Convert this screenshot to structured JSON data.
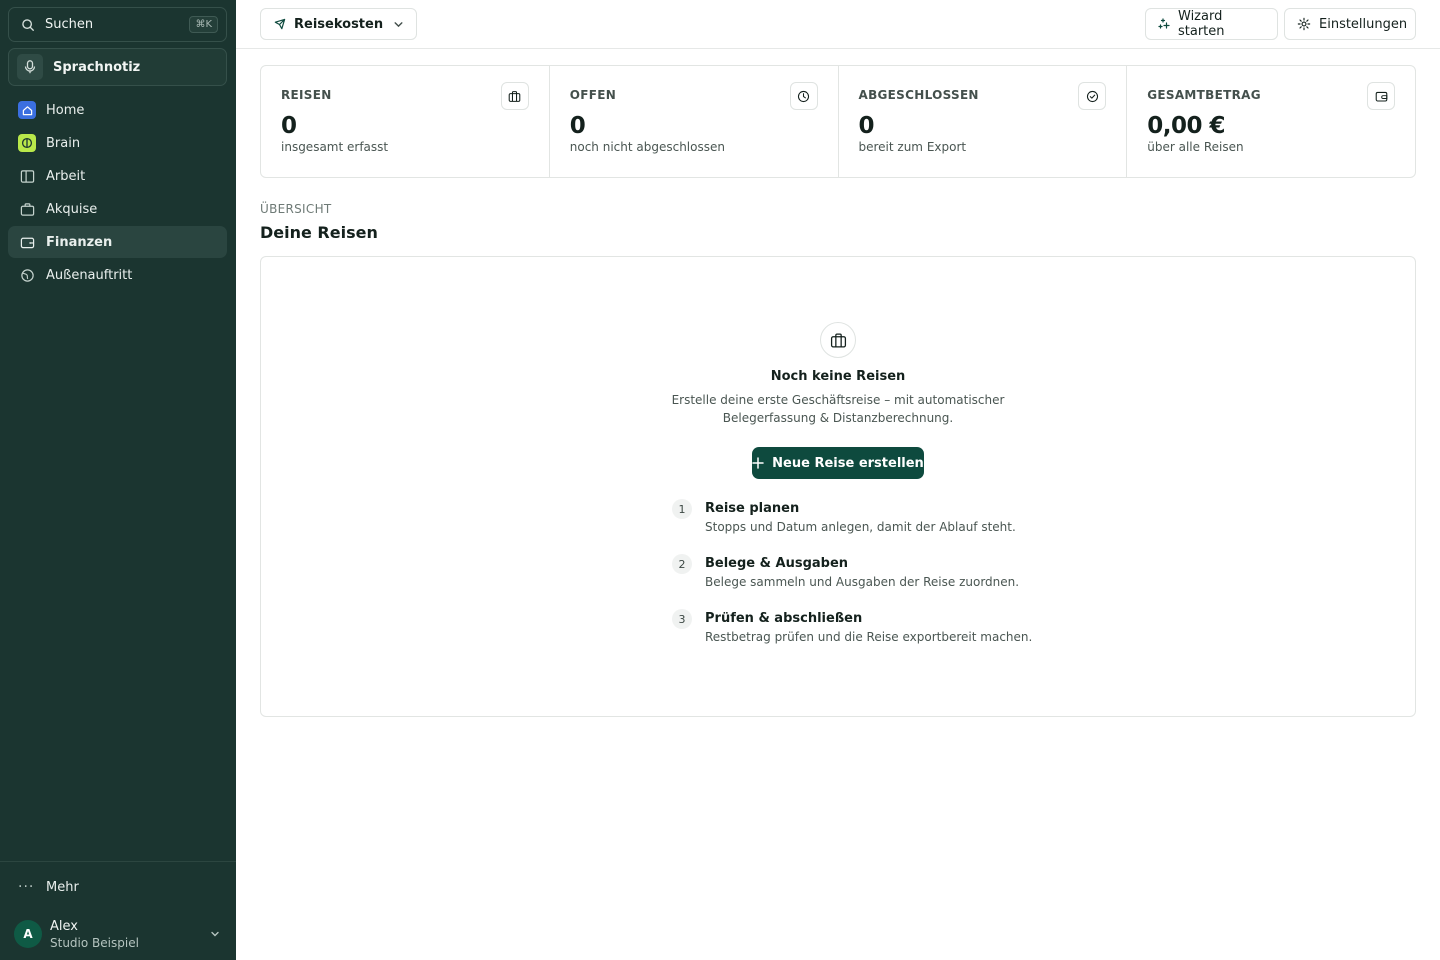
{
  "sidebar": {
    "search": {
      "label": "Suchen",
      "shortcut": "⌘K"
    },
    "voice_note": {
      "label": "Sprachnotiz"
    },
    "nav": [
      {
        "label": "Home",
        "icon": "home-icon"
      },
      {
        "label": "Brain",
        "icon": "brain-icon"
      },
      {
        "label": "Arbeit",
        "icon": "columns-icon"
      },
      {
        "label": "Akquise",
        "icon": "briefcase-icon"
      },
      {
        "label": "Finanzen",
        "icon": "wallet-icon",
        "active": true
      },
      {
        "label": "Außenauftritt",
        "icon": "globe-icon"
      }
    ],
    "more": {
      "label": "Mehr"
    },
    "user": {
      "initial": "A",
      "name": "Alex",
      "org": "Studio Beispiel"
    }
  },
  "topbar": {
    "module": {
      "label": "Reisekosten"
    },
    "wizard_label": "Wizard starten",
    "settings_label": "Einstellungen"
  },
  "stats": [
    {
      "label": "REISEN",
      "value": "0",
      "sub": "insgesamt erfasst",
      "icon": "briefcase-icon"
    },
    {
      "label": "OFFEN",
      "value": "0",
      "sub": "noch nicht abgeschlossen",
      "icon": "clock-icon"
    },
    {
      "label": "ABGESCHLOSSEN",
      "value": "0",
      "sub": "bereit zum Export",
      "icon": "check-circle-icon"
    },
    {
      "label": "GESAMTBETRAG",
      "value": "0,00 €",
      "sub": "über alle Reisen",
      "icon": "wallet-icon"
    }
  ],
  "section": {
    "eyebrow": "ÜBERSICHT",
    "title": "Deine Reisen"
  },
  "empty_state": {
    "title": "Noch keine Reisen",
    "text": "Erstelle deine erste Geschäftsreise – mit automatischer Belegerfassung & Distanzberechnung.",
    "cta_label": "Neue Reise erstellen",
    "steps": [
      {
        "num": "1",
        "title": "Reise planen",
        "desc": "Stopps und Datum anlegen, damit der Ablauf steht."
      },
      {
        "num": "2",
        "title": "Belege & Ausgaben",
        "desc": "Belege sammeln und Ausgaben der Reise zuordnen."
      },
      {
        "num": "3",
        "title": "Prüfen & abschließen",
        "desc": "Restbetrag prüfen und die Reise exportbereit machen."
      }
    ]
  },
  "colors": {
    "sidebar": "#1b3530",
    "primary": "#0e4a3e",
    "home_accent": "#3b6fe0",
    "brain_accent": "#b9e84a"
  }
}
